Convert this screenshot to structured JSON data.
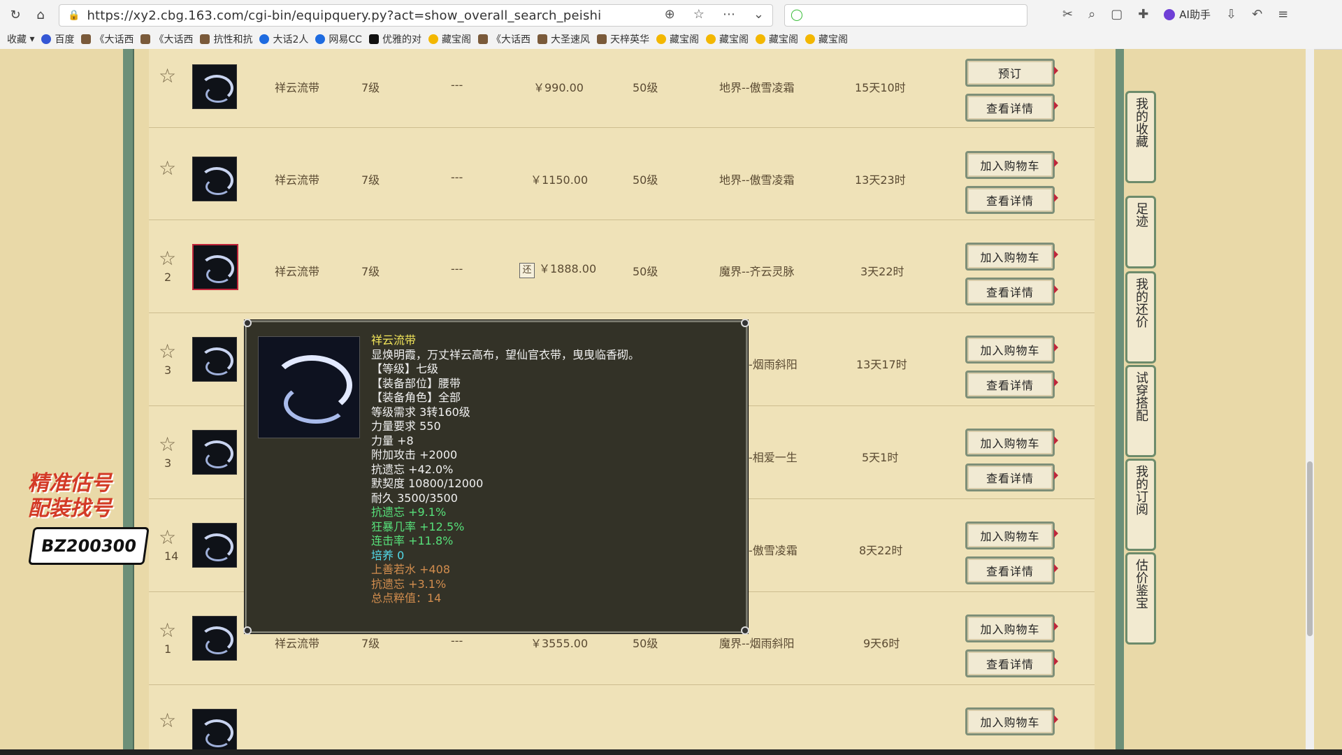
{
  "browser": {
    "url": "https://xy2.cbg.163.com/cgi-bin/equipquery.py?act=show_overall_search_peishi",
    "ai_helper_label": "AI助手",
    "bookmarks": [
      "收藏",
      "百度",
      "《大话西",
      "《大话西",
      "抗性和抗",
      "大话2人",
      "网易CC",
      "优雅的对",
      "藏宝阁",
      "《大话西",
      "大圣速风",
      "天梓英华",
      "藏宝阁",
      "藏宝阁",
      "藏宝阁",
      "藏宝阁"
    ]
  },
  "table": {
    "rows": [
      {
        "rank": "",
        "name": "祥云流带",
        "level": "7级",
        "dash": "---",
        "price": "￥990.00",
        "req": "50级",
        "server": "地界--傲雪凌霜",
        "time": "15天10时",
        "btn1": "预订",
        "btn2": "查看详情"
      },
      {
        "rank": "",
        "name": "祥云流带",
        "level": "7级",
        "dash": "---",
        "price": "￥1150.00",
        "req": "50级",
        "server": "地界--傲雪凌霜",
        "time": "13天23时",
        "btn1": "加入购物车",
        "btn2": "查看详情"
      },
      {
        "rank": "2",
        "name": "祥云流带",
        "level": "7级",
        "dash": "---",
        "price": "￥1888.00",
        "req": "50级",
        "server": "魔界--齐云灵脉",
        "time": "3天22时",
        "btn1": "加入购物车",
        "btn2": "查看详情",
        "bargain": "还"
      },
      {
        "rank": "3",
        "server": "-烟雨斜阳",
        "time": "13天17时",
        "btn1": "加入购物车",
        "btn2": "查看详情"
      },
      {
        "rank": "3",
        "server": "-相爱一生",
        "time": "5天1时",
        "btn1": "加入购物车",
        "btn2": "查看详情"
      },
      {
        "rank": "14",
        "server": "-傲雪凌霜",
        "time": "8天22时",
        "btn1": "加入购物车",
        "btn2": "查看详情"
      },
      {
        "rank": "1",
        "name": "祥云流带",
        "level": "7级",
        "dash": "---",
        "price": "￥3555.00",
        "req": "50级",
        "server": "魔界--烟雨斜阳",
        "time": "9天6时",
        "btn1": "加入购物车",
        "btn2": "查看详情"
      },
      {
        "btn1": "加入购物车"
      }
    ]
  },
  "sidemenu": [
    "我的收藏",
    "足迹",
    "我的还价",
    "试穿搭配",
    "我的订阅",
    "估价鉴宝"
  ],
  "tooltip": {
    "title": "祥云流带",
    "desc": "显焕明霞，万丈祥云高布，望仙官衣带，曳曳临香砌。",
    "lines_white": [
      "【等级】七级",
      "【装备部位】腰带",
      "【装备角色】全部",
      "等级需求 3转160级",
      "力量要求 550",
      "力量 +8",
      "附加攻击 +2000",
      "抗遗忘 +42.0%",
      "默契度 10800/12000",
      "耐久 3500/3500"
    ],
    "lines_green": [
      "抗遗忘 +9.1%",
      "狂暴几率 +12.5%",
      "连击率 +11.8%"
    ],
    "line_cyan": "培养 0",
    "lines_orange": [
      "上善若水 +408",
      "抗遗忘 +3.1%",
      "总点粹值：14"
    ]
  },
  "watermark": {
    "line1": "精准估号",
    "line2": "配装找号",
    "code": "BZ200300"
  }
}
